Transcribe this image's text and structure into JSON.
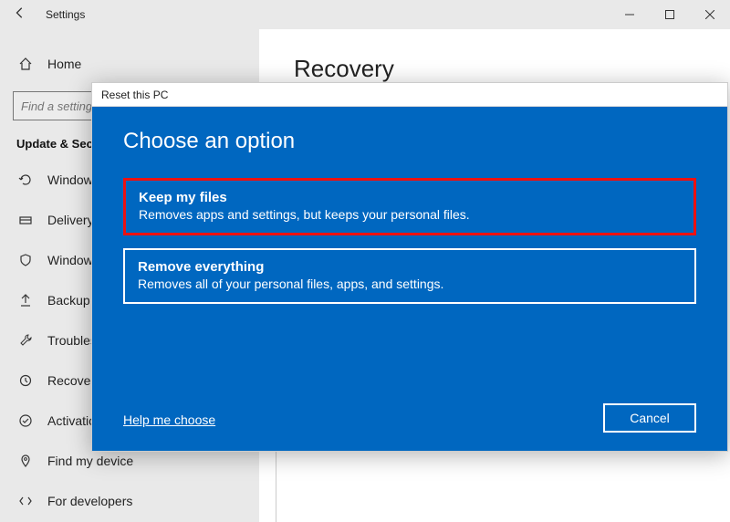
{
  "window": {
    "title": "Settings"
  },
  "sidebar": {
    "home": "Home",
    "search_placeholder": "Find a setting",
    "section": "Update & Security",
    "items": [
      {
        "label": "Windows Update"
      },
      {
        "label": "Delivery Optimization"
      },
      {
        "label": "Windows Security"
      },
      {
        "label": "Backup"
      },
      {
        "label": "Troubleshoot"
      },
      {
        "label": "Recovery"
      },
      {
        "label": "Activation"
      },
      {
        "label": "Find my device"
      },
      {
        "label": "For developers"
      }
    ]
  },
  "main": {
    "heading": "Recovery"
  },
  "modal": {
    "title": "Reset this PC",
    "heading": "Choose an option",
    "options": [
      {
        "title": "Keep my files",
        "desc": "Removes apps and settings, but keeps your personal files."
      },
      {
        "title": "Remove everything",
        "desc": "Removes all of your personal files, apps, and settings."
      }
    ],
    "help": "Help me choose",
    "cancel": "Cancel"
  }
}
